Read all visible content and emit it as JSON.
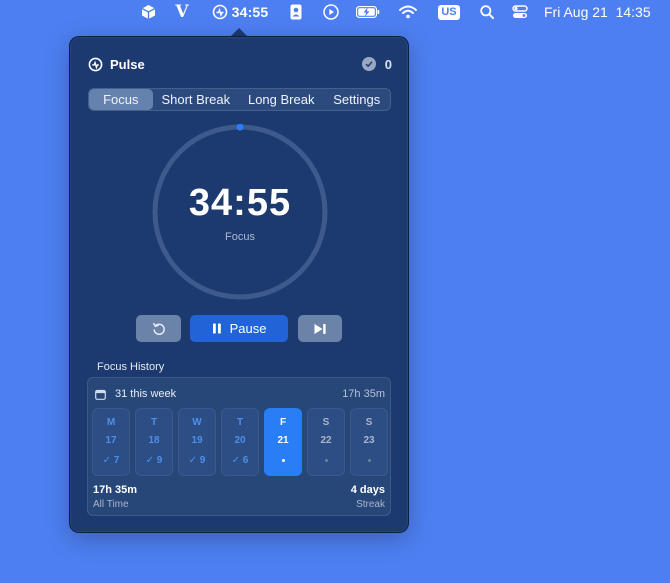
{
  "menubar": {
    "icons": [
      "cube-icon",
      "v-icon",
      "pulse-timer-icon",
      "contact-card-icon",
      "play-circle-icon",
      "battery-charging-icon",
      "wifi-icon",
      "search-icon",
      "control-center-icon"
    ],
    "timer_text": "34:55",
    "input_source": "US",
    "clock": "Fri Aug 21  14:35"
  },
  "popover": {
    "app_name": "Pulse",
    "completed_count": "0",
    "tabs": [
      {
        "label": "Focus",
        "active": true
      },
      {
        "label": "Short Break",
        "active": false
      },
      {
        "label": "Long Break",
        "active": false
      },
      {
        "label": "Settings",
        "active": false
      }
    ],
    "timer": {
      "time": "34:55",
      "mode": "Focus",
      "progress": 0.0
    },
    "controls": {
      "reset_icon": "reset-icon",
      "pause_label": "Pause",
      "pause_icon": "pause-icon",
      "skip_icon": "skip-icon"
    },
    "history": {
      "title": "Focus History",
      "week_label": "31 this week",
      "week_total": "17h 35m",
      "days": [
        {
          "letter": "M",
          "date": "17",
          "count": "✓ 7",
          "state": "past"
        },
        {
          "letter": "T",
          "date": "18",
          "count": "✓ 9",
          "state": "past"
        },
        {
          "letter": "W",
          "date": "19",
          "count": "✓ 9",
          "state": "past"
        },
        {
          "letter": "T",
          "date": "20",
          "count": "✓ 6",
          "state": "past"
        },
        {
          "letter": "F",
          "date": "21",
          "count": "",
          "state": "today"
        },
        {
          "letter": "S",
          "date": "22",
          "count": "",
          "state": "future"
        },
        {
          "letter": "S",
          "date": "23",
          "count": "",
          "state": "future"
        }
      ],
      "all_time_value": "17h 35m",
      "all_time_label": "All Time",
      "streak_value": "4 days",
      "streak_label": "Streak"
    }
  },
  "colors": {
    "desktop": "#4e7ff2",
    "popover_bg": "#1c3a70",
    "accent": "#2a7ef5",
    "ring_track": "#3e5a8d"
  }
}
